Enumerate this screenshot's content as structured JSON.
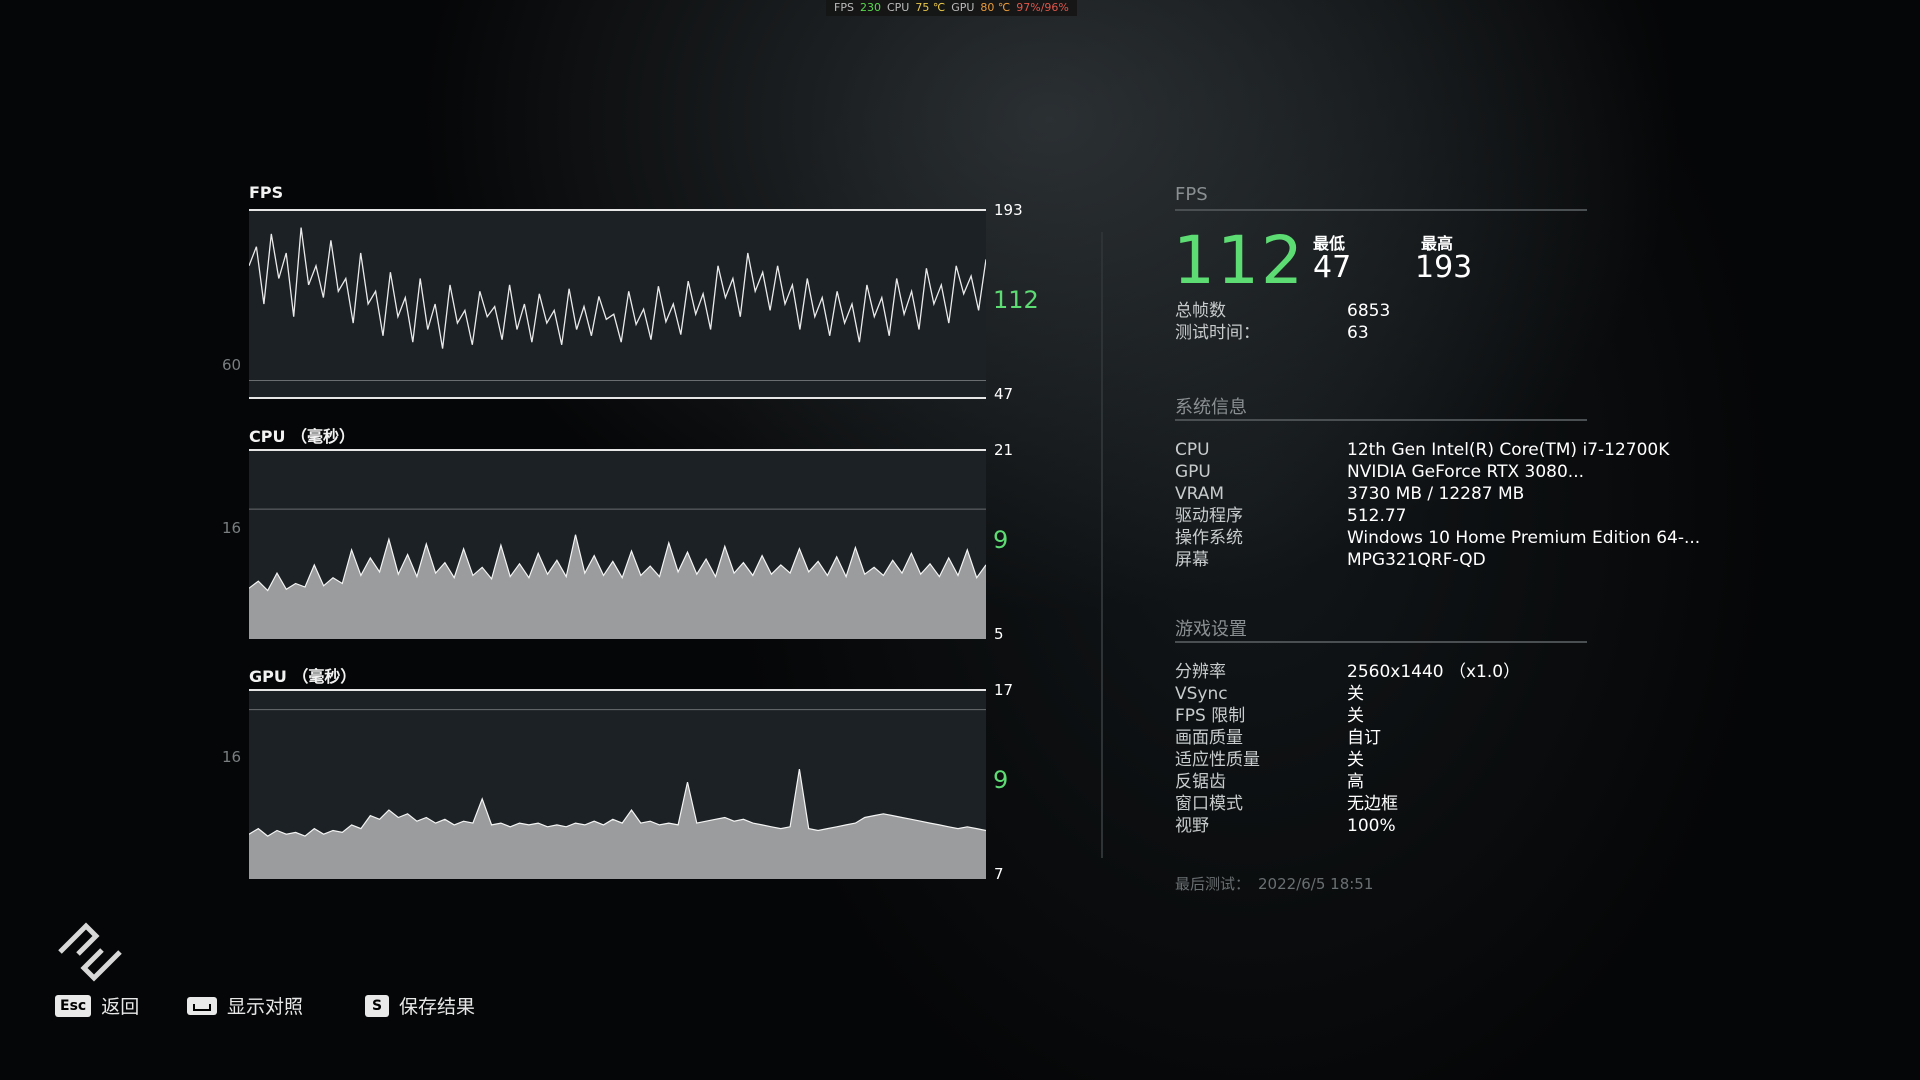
{
  "overlay": {
    "fps_label": "FPS",
    "fps_value": "230",
    "cpu_label": "CPU",
    "cpu_temp": "75 ℃",
    "gpu_label": "GPU",
    "gpu_temp": "80 ℃",
    "gpu_usage": "97%/96%"
  },
  "charts": {
    "fps": {
      "title": "FPS",
      "axis_top": "193",
      "axis_current": "112",
      "axis_bottom": "47",
      "ref_label": "60"
    },
    "cpu": {
      "title": "CPU （毫秒）",
      "axis_top": "21",
      "axis_current": "9",
      "axis_bottom": "5",
      "ref_label": "16"
    },
    "gpu": {
      "title": "GPU （毫秒）",
      "axis_top": "17",
      "axis_current": "9",
      "axis_bottom": "7",
      "ref_label": "16"
    }
  },
  "chart_data": [
    {
      "type": "line",
      "title": "FPS",
      "ylim": [
        47,
        193
      ],
      "reference_line": 60,
      "current": 112,
      "series": [
        {
          "values": [
            150,
            165,
            120,
            175,
            140,
            160,
            110,
            180,
            135,
            150,
            125,
            170,
            130,
            140,
            105,
            160,
            120,
            130,
            95,
            145,
            110,
            125,
            90,
            140,
            100,
            120,
            85,
            135,
            105,
            115,
            88,
            130,
            110,
            118,
            92,
            135,
            100,
            120,
            90,
            128,
            105,
            115,
            88,
            132,
            100,
            118,
            95,
            126,
            108,
            112,
            90,
            130,
            104,
            116,
            92,
            134,
            106,
            120,
            96,
            138,
            112,
            128,
            100,
            150,
            125,
            140,
            110,
            160,
            130,
            145,
            115,
            150,
            120,
            135,
            100,
            140,
            110,
            125,
            95,
            130,
            105,
            120,
            90,
            135,
            110,
            125,
            95,
            140,
            112,
            130,
            100,
            148,
            120,
            135,
            105,
            150,
            128,
            142,
            115,
            155
          ]
        }
      ]
    },
    {
      "type": "area",
      "title": "CPU （毫秒）",
      "ylim": [
        5,
        21
      ],
      "reference_line": 16,
      "current": 9,
      "series": [
        {
          "values": [
            9.2,
            9.8,
            9.0,
            10.5,
            9.1,
            9.6,
            9.3,
            11.2,
            9.4,
            10.1,
            9.6,
            12.5,
            10.3,
            11.8,
            10.6,
            13.4,
            10.4,
            12.1,
            10.2,
            13.0,
            10.5,
            11.4,
            10.1,
            12.6,
            10.3,
            11.0,
            10.0,
            12.9,
            10.2,
            11.3,
            10.1,
            12.2,
            10.4,
            11.6,
            10.2,
            13.8,
            10.5,
            12.0,
            10.3,
            11.5,
            10.1,
            12.4,
            10.3,
            11.1,
            10.2,
            13.1,
            10.6,
            12.3,
            10.4,
            11.7,
            10.2,
            12.8,
            10.5,
            11.4,
            10.3,
            12.0,
            10.4,
            11.2,
            10.5,
            12.6,
            10.6,
            11.5,
            10.3,
            11.9,
            10.2,
            12.7,
            10.4,
            11.0,
            10.3,
            11.6,
            10.5,
            12.2,
            10.4,
            11.3,
            10.2,
            11.8,
            10.3,
            12.5,
            10.1,
            11.2
          ]
        }
      ]
    },
    {
      "type": "area",
      "title": "GPU （毫秒）",
      "ylim": [
        7,
        17
      ],
      "reference_line": 16,
      "current": 9,
      "series": [
        {
          "values": [
            9.3,
            9.6,
            9.2,
            9.5,
            9.3,
            9.4,
            9.2,
            9.6,
            9.3,
            9.5,
            9.4,
            9.8,
            9.6,
            10.3,
            10.1,
            10.6,
            10.2,
            10.4,
            10.0,
            10.2,
            9.9,
            10.1,
            9.8,
            10.0,
            9.9,
            11.2,
            9.8,
            9.9,
            9.7,
            9.9,
            9.8,
            9.9,
            9.7,
            9.8,
            9.7,
            9.9,
            9.8,
            10.0,
            9.8,
            10.1,
            9.9,
            10.6,
            9.9,
            10.0,
            9.8,
            9.9,
            9.8,
            12.1,
            9.9,
            10.0,
            10.1,
            10.2,
            10.0,
            10.1,
            9.9,
            9.8,
            9.7,
            9.6,
            9.7,
            12.8,
            9.6,
            9.5,
            9.6,
            9.7,
            9.8,
            9.9,
            10.2,
            10.3,
            10.4,
            10.3,
            10.2,
            10.1,
            10.0,
            9.9,
            9.8,
            9.7,
            9.6,
            9.7,
            9.6,
            9.5
          ]
        }
      ]
    }
  ],
  "fps_panel": {
    "section_title": "FPS",
    "avg": "112",
    "min_label": "最低",
    "min_value": "47",
    "max_label": "最高",
    "max_value": "193",
    "total_frames_label": "总帧数",
    "total_frames_value": "6853",
    "test_time_label": "测试时间：",
    "test_time_value": "63"
  },
  "system_info": {
    "section_title": "系统信息",
    "items": [
      {
        "key": "CPU",
        "value": "12th Gen Intel(R) Core(TM) i7-12700K"
      },
      {
        "key": "GPU",
        "value": "NVIDIA GeForce RTX 3080..."
      },
      {
        "key": "VRAM",
        "value": "3730 MB / 12287 MB"
      },
      {
        "key": "驱动程序",
        "value": "512.77"
      },
      {
        "key": "操作系统",
        "value": "Windows 10 Home Premium Edition 64-..."
      },
      {
        "key": "屏幕",
        "value": "MPG321QRF-QD"
      }
    ]
  },
  "game_settings": {
    "section_title": "游戏设置",
    "items": [
      {
        "key": "分辨率",
        "value": "2560x1440 （x1.0）"
      },
      {
        "key": "VSync",
        "value": "关"
      },
      {
        "key": "FPS 限制",
        "value": "关"
      },
      {
        "key": "画面质量",
        "value": "自订"
      },
      {
        "key": "适应性质量",
        "value": "关"
      },
      {
        "key": "反锯齿",
        "value": "高"
      },
      {
        "key": "窗口模式",
        "value": "无边框"
      },
      {
        "key": "视野",
        "value": "100%"
      }
    ]
  },
  "last_test": {
    "label": "最后测试：",
    "value": "2022/6/5 18:51"
  },
  "hints": {
    "back_key": "Esc",
    "back_label": "返回",
    "compare_label": "显示对照",
    "save_key": "S",
    "save_label": "保存结果"
  },
  "colors": {
    "accent_green": "#5ddc74",
    "chart_fill": "#9a9c9d",
    "chart_bg": "#1b2124"
  }
}
